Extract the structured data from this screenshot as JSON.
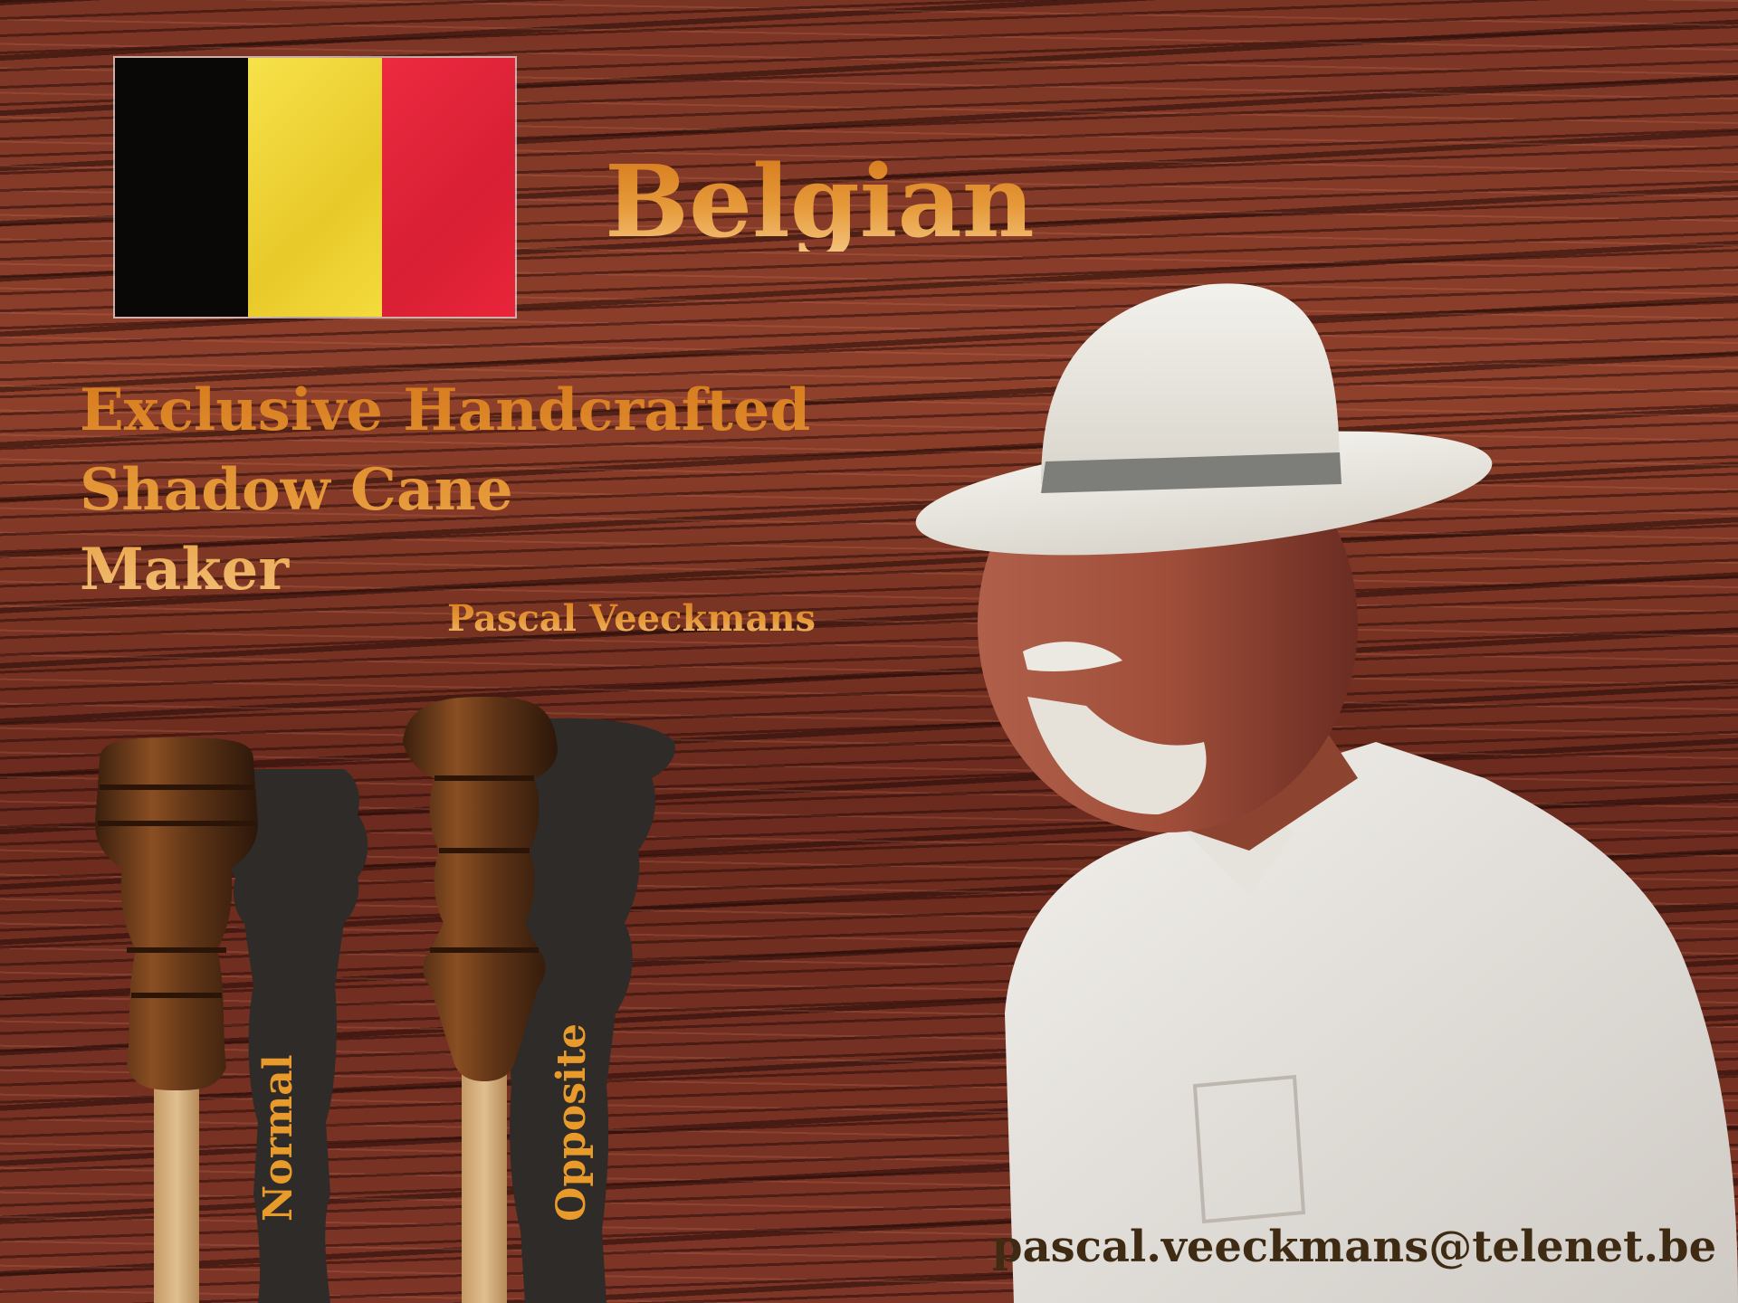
{
  "page": {
    "title": "Belgian",
    "tagline": [
      "Exclusive Handcrafted",
      "Shadow Cane",
      "Maker"
    ],
    "maker_name": "Pascal Veeckmans",
    "email": "pascal.veeckmans@telenet.be"
  },
  "flag": {
    "name": "belgium-flag",
    "colors": [
      "#0a0807",
      "#f4dc36",
      "#e6223a"
    ]
  },
  "canes": [
    {
      "label": "Normal"
    },
    {
      "label": "Opposite"
    }
  ],
  "colors": {
    "title_gold": "#e69a3a",
    "email_text": "#3f2b14",
    "label_orange": "#e89a2a"
  }
}
